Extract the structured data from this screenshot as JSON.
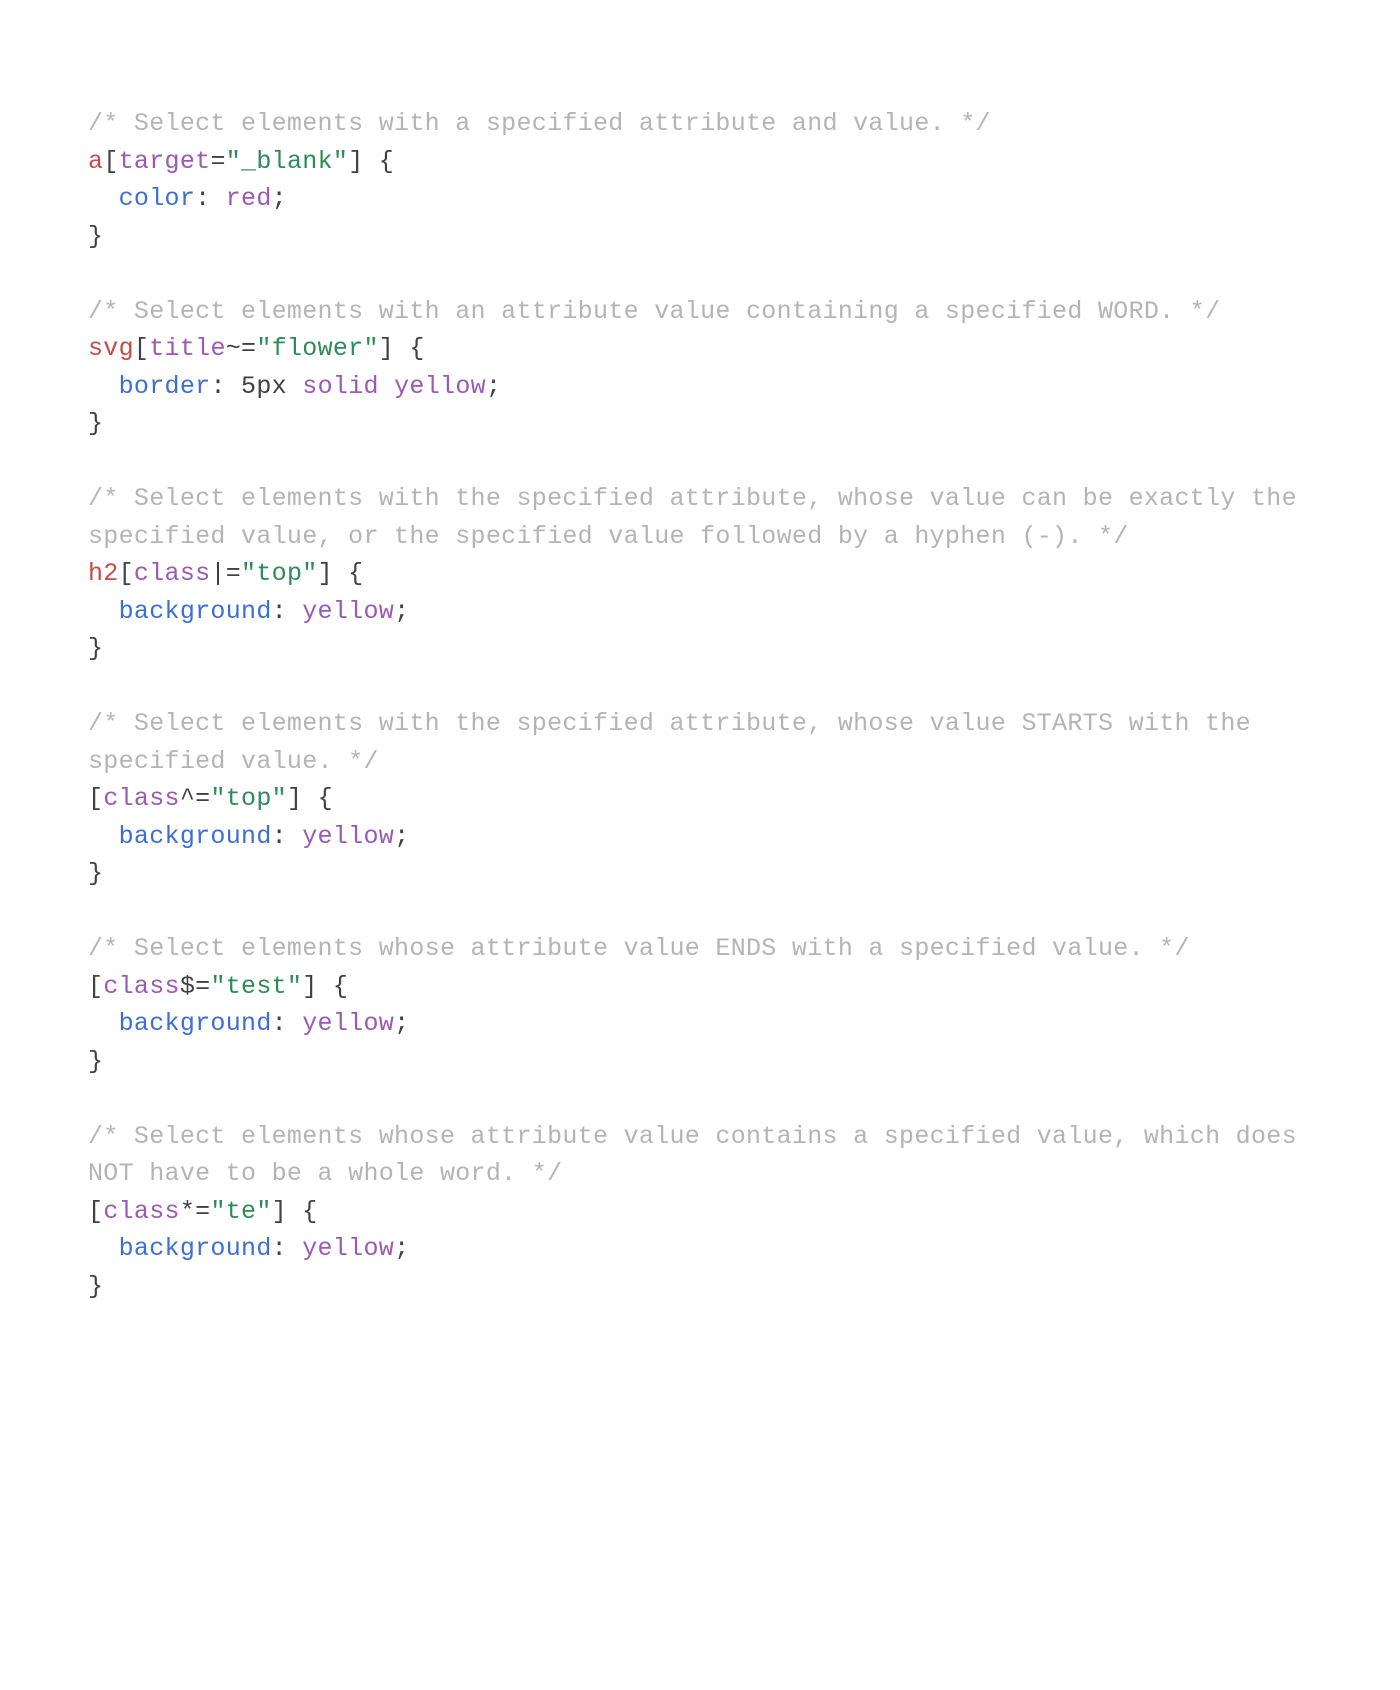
{
  "block1": {
    "comment": "/* Select elements with a specified attribute and value. */",
    "tag": "a",
    "lb": "[",
    "attr": "target",
    "op": "=",
    "str": "\"_blank\"",
    "rb": "]",
    "ob": " {",
    "prop": "color",
    "colon": ": ",
    "val": "red",
    "semi": ";",
    "cb": "}"
  },
  "block2": {
    "comment": "/* Select elements with an attribute value containing a specified WORD. */",
    "tag": "svg",
    "lb": "[",
    "attr": "title",
    "op": "~=",
    "str": "\"flower\"",
    "rb": "]",
    "ob": " {",
    "prop": "border",
    "colon": ": ",
    "num": "5px",
    "sp1": " ",
    "kw": "solid",
    "sp2": " ",
    "val": "yellow",
    "semi": ";",
    "cb": "}"
  },
  "block3": {
    "comment": "/* Select elements with the specified attribute, whose value can be exactly the specified value, or the specified value followed by a hyphen (-). */",
    "tag": "h2",
    "lb": "[",
    "attr": "class",
    "op": "|=",
    "str": "\"top\"",
    "rb": "]",
    "ob": " {",
    "prop": "background",
    "colon": ": ",
    "val": "yellow",
    "semi": ";",
    "cb": "}"
  },
  "block4": {
    "comment": "/* Select elements with the specified attribute, whose value STARTS with the specified value. */",
    "lb": "[",
    "attr": "class",
    "op": "^=",
    "str": "\"top\"",
    "rb": "]",
    "ob": " {",
    "prop": "background",
    "colon": ": ",
    "val": "yellow",
    "semi": ";",
    "cb": "}"
  },
  "block5": {
    "comment": "/* Select elements whose attribute value ENDS with a specified value. */",
    "lb": "[",
    "attr": "class",
    "op": "$=",
    "str": "\"test\"",
    "rb": "]",
    "ob": " {",
    "prop": "background",
    "colon": ": ",
    "val": "yellow",
    "semi": ";",
    "cb": "}"
  },
  "block6": {
    "comment": "/* Select elements whose attribute value contains a specified value, which does NOT have to be a whole word. */",
    "lb": "[",
    "attr": "class",
    "op": "*=",
    "str": "\"te\"",
    "rb": "]",
    "ob": " {",
    "prop": "background",
    "colon": ": ",
    "val": "yellow",
    "semi": ";",
    "cb": "}"
  }
}
